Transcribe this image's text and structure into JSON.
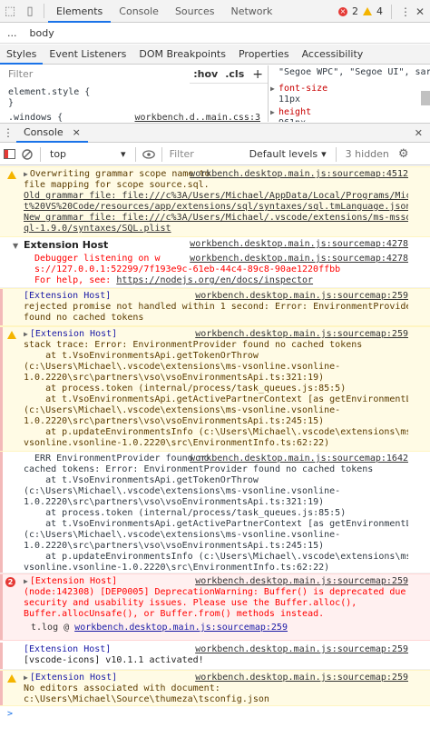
{
  "topbar": {
    "tabs": [
      "Elements",
      "Console",
      "Sources",
      "Network"
    ],
    "active_tab": "Elements",
    "error_count": "2",
    "warning_count": "4"
  },
  "breadcrumb": {
    "ellipsis": "...",
    "item": "body"
  },
  "subtabs": [
    "Styles",
    "Event Listeners",
    "DOM Breakpoints",
    "Properties",
    "Accessibility"
  ],
  "styles": {
    "filter_placeholder": "Filter",
    "hov": ":hov",
    "cls": ".cls",
    "plus": "+",
    "element_style": "element.style {",
    "element_style_close": "}",
    "rule_selector": ".windows {",
    "rule_source": "workbench.d..main.css:3"
  },
  "computed": {
    "font_line": "\"Segoe WPC\", \"Segoe UI\", sar",
    "prop1": "font-size",
    "val1": "11px",
    "prop2": "height",
    "val2": "961px"
  },
  "drawer": {
    "tab": "Console",
    "close": "×"
  },
  "console_toolbar": {
    "context": "top",
    "filter_placeholder": "Filter",
    "levels": "Default levels",
    "hidden": "3 hidden"
  },
  "messages": {
    "m1": {
      "source": "workbench.desktop.main.js:sourcemap:4512",
      "lines": [
        "Overwriting grammar scope name to",
        "file mapping for scope source.sql.",
        "Old grammar file: file:///c%3A/Users/Michael/AppData/Local/Programs/Microsof",
        "t%20VS%20Code/resources/app/extensions/sql/syntaxes/sql.tmLanguage.json.",
        "New grammar file: file:///c%3A/Users/Michael/.vscode/extensions/ms-mssql.mss",
        "ql-1.9.0/syntaxes/SQL.plist"
      ]
    },
    "m2": {
      "title": "Extension Host",
      "source": "workbench.desktop.main.js:sourcemap:4278"
    },
    "m3": {
      "source": "workbench.desktop.main.js:sourcemap:4278",
      "line1": "Debugger listening on w",
      "line2": "s://127.0.0.1:52299/7f193e9c-61eb-44c4-89c8-90ae1220ffbb",
      "line3_prefix": "For help, see: ",
      "line3_link": "https://nodejs.org/en/docs/inspector"
    },
    "m4": {
      "source": "workbench.desktop.main.js:sourcemap:259",
      "lines": [
        "[Extension Host]",
        "rejected promise not handled within 1 second: Error: EnvironmentProvider",
        "found no cached tokens"
      ]
    },
    "m5": {
      "source": "workbench.desktop.main.js:sourcemap:259",
      "lines": [
        "[Extension Host]",
        "stack trace: Error: EnvironmentProvider found no cached tokens",
        "    at t.VsoEnvironmentsApi.getTokenOrThrow",
        "(c:\\Users\\Michael\\.vscode\\extensions\\ms-vsonline.vsonline-",
        "1.0.2220\\src\\partners\\vso\\vsoEnvironmentsApi.ts:321:19)",
        "    at process.token (internal/process/task_queues.js:85:5)",
        "    at t.VsoEnvironmentsApi.getActivePartnerContext [as getEnvironmentList]",
        "(c:\\Users\\Michael\\.vscode\\extensions\\ms-vsonline.vsonline-",
        "1.0.2220\\src\\partners\\vso\\vsoEnvironmentsApi.ts:245:15)",
        "    at p.updateEnvironmentsInfo (c:\\Users\\Michael\\.vscode\\extensions\\ms-",
        "vsonline.vsonline-1.0.2220\\src\\EnvironmentInfo.ts:62:22)"
      ]
    },
    "m6": {
      "source": "workbench.desktop.main.js:sourcemap:1642",
      "lines": [
        "  ERR EnvironmentProvider found no",
        "cached tokens: Error: EnvironmentProvider found no cached tokens",
        "    at t.VsoEnvironmentsApi.getTokenOrThrow",
        "(c:\\Users\\Michael\\.vscode\\extensions\\ms-vsonline.vsonline-",
        "1.0.2220\\src\\partners\\vso\\vsoEnvironmentsApi.ts:321:19)",
        "    at process.token (internal/process/task_queues.js:85:5)",
        "    at t.VsoEnvironmentsApi.getActivePartnerContext [as getEnvironmentList]",
        "(c:\\Users\\Michael\\.vscode\\extensions\\ms-vsonline.vsonline-",
        "1.0.2220\\src\\partners\\vso\\vsoEnvironmentsApi.ts:245:15)",
        "    at p.updateEnvironmentsInfo (c:\\Users\\Michael\\.vscode\\extensions\\ms-",
        "vsonline.vsonline-1.0.2220\\src\\EnvironmentInfo.ts:62:22)"
      ]
    },
    "m7": {
      "count": "2",
      "source": "workbench.desktop.main.js:sourcemap:259",
      "lines": [
        "[Extension Host]",
        "(node:142308) [DEP0005] DeprecationWarning: Buffer() is deprecated due to",
        "security and usability issues. Please use the Buffer.alloc(),",
        "Buffer.allocUnsafe(), or Buffer.from() methods instead."
      ],
      "trace_prefix": "t.log @ ",
      "trace_link": "workbench.desktop.main.js:sourcemap:259"
    },
    "m8": {
      "source": "workbench.desktop.main.js:sourcemap:259",
      "lines": [
        "[Extension Host]",
        "[vscode-icons] v10.1.1 activated!"
      ]
    },
    "m9": {
      "source": "workbench.desktop.main.js:sourcemap:259",
      "lines": [
        "[Extension Host]",
        "No editors associated with document:",
        "c:\\Users\\Michael\\Source\\thumeza\\tsconfig.json"
      ]
    },
    "prompt": ">"
  }
}
